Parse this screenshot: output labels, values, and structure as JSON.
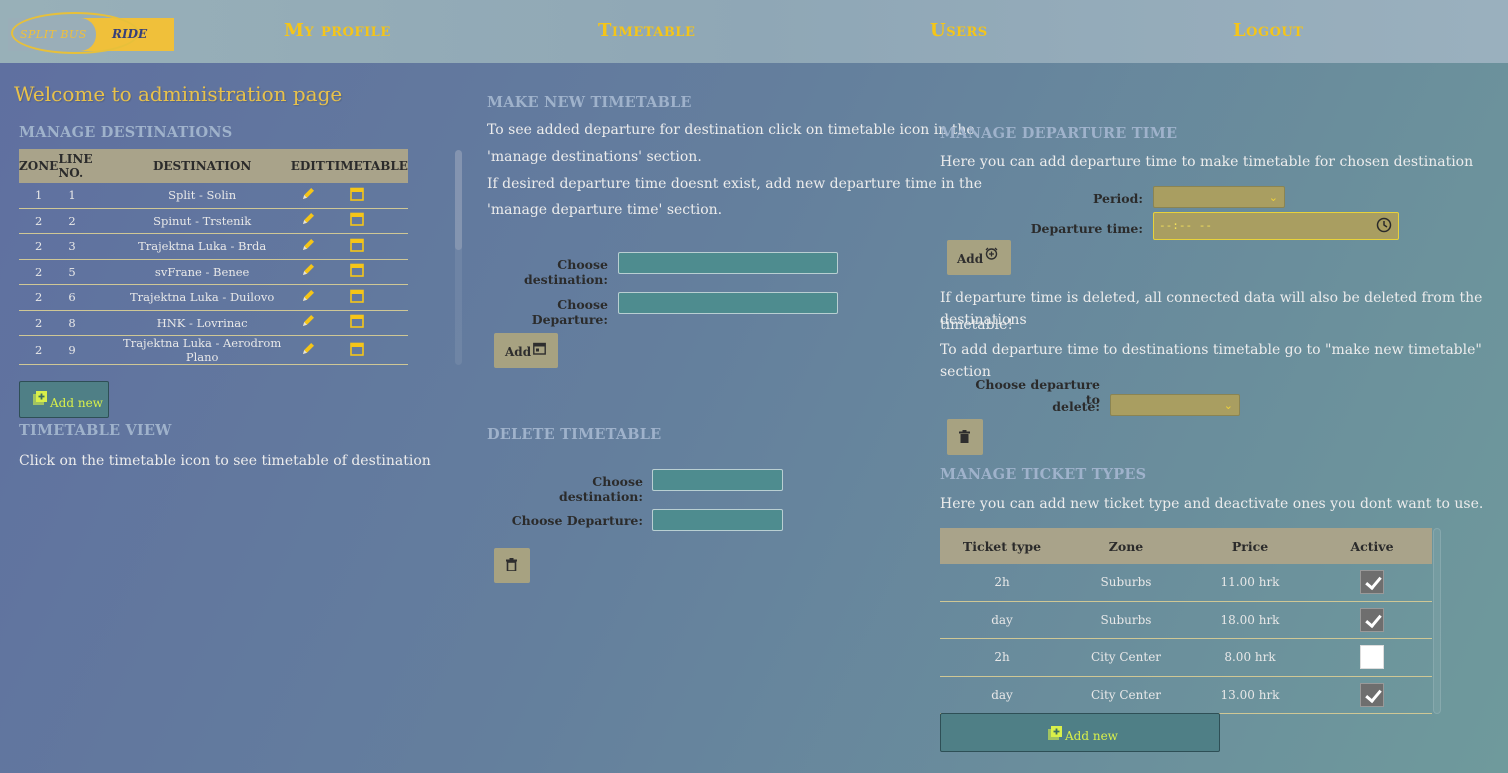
{
  "nav": {
    "logo_left": "SPLIT BUS",
    "logo_right": "RIDE",
    "my_profile": "My profile",
    "timetable": "Timetable",
    "users": "Users",
    "logout": "Logout"
  },
  "welcome": "Welcome to administration page",
  "destinations": {
    "title": "MANAGE DESTINATIONS",
    "headers": [
      "ZONE",
      "LINE NO.",
      "DESTINATION",
      "EDIT",
      "TIMETABLE"
    ],
    "rows": [
      {
        "zone": "1",
        "line": "1",
        "destination": "Split - Solin"
      },
      {
        "zone": "2",
        "line": "2",
        "destination": "Spinut - Trstenik"
      },
      {
        "zone": "2",
        "line": "3",
        "destination": "Trajektna Luka - Brda"
      },
      {
        "zone": "2",
        "line": "5",
        "destination": "svFrane - Benee"
      },
      {
        "zone": "2",
        "line": "6",
        "destination": "Trajektna Luka - Duilovo"
      },
      {
        "zone": "2",
        "line": "8",
        "destination": "HNK - Lovrinac"
      },
      {
        "zone": "2",
        "line": "9",
        "destination": "Trajektna Luka - Aerodrom Plano"
      }
    ],
    "add_new": "Add new"
  },
  "timetable_view": {
    "title": "TIMETABLE VIEW",
    "text": "Click on the timetable icon to see timetable of destination"
  },
  "make_timetable": {
    "title": "MAKE NEW TIMETABLE",
    "line1": "To see added departure for destination click on timetable icon in the",
    "line2": "'manage destinations' section.",
    "line3": "If desired departure time doesnt exist, add new departure time in the",
    "line4": "'manage departure time' section.",
    "choose_destination": "Choose destination:",
    "choose_departure": "Choose Departure:",
    "add": "Add"
  },
  "delete_timetable": {
    "title": "DELETE TIMETABLE",
    "choose_destination": "Choose destination:",
    "choose_departure": "Choose Departure:"
  },
  "departure_time": {
    "title": "MANAGE DEPARTURE TIME",
    "intro": "Here you can add departure time to make timetable for chosen destination",
    "period_label": "Period:",
    "departure_label": "Departure time:",
    "departure_value": "--:-- --",
    "add": "Add",
    "warn1": "If departure time is deleted, all connected data will also be deleted from the destinations",
    "warn2": "timetable!",
    "warn3": "To add departure time to destinations timetable go to \"make new timetable\" section",
    "delete_label_1": "Choose departure to",
    "delete_label_2": "delete:"
  },
  "tickets": {
    "title": "MANAGE TICKET TYPES",
    "intro": "Here you can add new ticket type and deactivate ones you dont want to use.",
    "headers": [
      "Ticket type",
      "Zone",
      "Price",
      "Active"
    ],
    "rows": [
      {
        "type": "2h",
        "zone": "Suburbs",
        "price": "11.00 hrk",
        "active": true
      },
      {
        "type": "day",
        "zone": "Suburbs",
        "price": "18.00 hrk",
        "active": true
      },
      {
        "type": "2h",
        "zone": "City Center",
        "price": "8.00 hrk",
        "active": false
      },
      {
        "type": "day",
        "zone": "City Center",
        "price": "13.00 hrk",
        "active": true
      }
    ],
    "add_new": "Add new"
  }
}
